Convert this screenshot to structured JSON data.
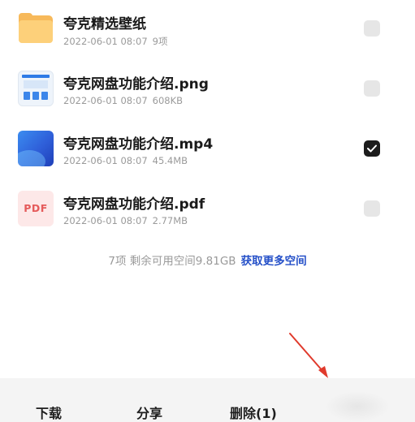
{
  "files": [
    {
      "name": "夸克精选壁纸",
      "date": "2022-06-01 08:07",
      "detail": "9项",
      "type": "folder",
      "checked": false,
      "icon": "folder-icon"
    },
    {
      "name": "夸克网盘功能介绍.png",
      "date": "2022-06-01 08:07",
      "detail": "608KB",
      "type": "png",
      "checked": false,
      "icon": "image-thumbnail"
    },
    {
      "name": "夸克网盘功能介绍.mp4",
      "date": "2022-06-01 08:07",
      "detail": "45.4MB",
      "type": "mp4",
      "checked": true,
      "icon": "video-thumbnail"
    },
    {
      "name": "夸克网盘功能介绍.pdf",
      "date": "2022-06-01 08:07",
      "detail": "2.77MB",
      "type": "pdf",
      "checked": false,
      "icon": "pdf-icon",
      "icon_label": "PDF"
    }
  ],
  "summary": {
    "text": "7项 剩余可用空间9.81GB",
    "link": "获取更多空间"
  },
  "toolbar": {
    "download": "下载",
    "share": "分享",
    "delete": "删除(1)"
  },
  "colors": {
    "accent_link": "#2550c8",
    "checked_box": "#1c1c1c",
    "unchecked_box": "#e6e6e6",
    "annotation_arrow": "#e03a2c",
    "toolbar_bg": "#f4f4f4"
  }
}
